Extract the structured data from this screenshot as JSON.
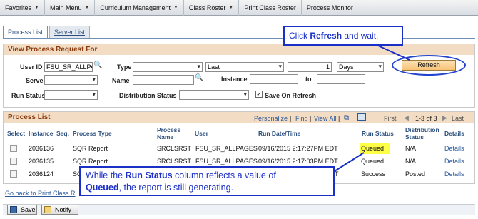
{
  "nav": {
    "items": [
      {
        "label": "Favorites",
        "caret": true
      },
      {
        "label": "Main Menu",
        "caret": true
      },
      {
        "label": "Curriculum Management",
        "caret": true
      },
      {
        "label": "Class Roster",
        "caret": true
      },
      {
        "label": "Print Class Roster",
        "caret": false
      },
      {
        "label": "Process Monitor",
        "caret": false
      }
    ]
  },
  "tabs": {
    "process_list": "Process List",
    "server_list": "Server List"
  },
  "request": {
    "title": "View Process Request For",
    "user_id_label": "User ID",
    "user_id_value": "FSU_SR_ALLPA",
    "type_label": "Type",
    "last_value": "Last",
    "number_value": "1",
    "days_value": "Days",
    "refresh_label": "Refresh",
    "server_label": "Server",
    "name_label": "Name",
    "instance_label": "Instance",
    "to_label": "to",
    "run_status_label": "Run Status",
    "distribution_status_label": "Distribution Status",
    "save_on_refresh_label": "Save On Refresh"
  },
  "process_list": {
    "title": "Process List",
    "personalize": "Personalize",
    "find": "Find",
    "view_all": "View All",
    "first": "First",
    "range": "1-3 of 3",
    "last": "Last",
    "columns": [
      "Select",
      "Instance",
      "Seq.",
      "Process Type",
      "Process Name",
      "User",
      "Run Date/Time",
      "Run Status",
      "Distribution Status",
      "Details"
    ],
    "rows": [
      {
        "instance": "2036136",
        "seq": "",
        "type": "SQR Report",
        "name": "SRCLSRST",
        "user": "FSU_SR_ALLPAGES",
        "datetime": "09/16/2015  2:17:27PM EDT",
        "status": "Queued",
        "dist": "N/A",
        "details": "Details"
      },
      {
        "instance": "2036135",
        "seq": "",
        "type": "SQR Report",
        "name": "SRCLSRST",
        "user": "FSU_SR_ALLPAGES",
        "datetime": "09/16/2015  2:17:03PM EDT",
        "status": "Queued",
        "dist": "N/A",
        "details": "Details"
      },
      {
        "instance": "2036124",
        "seq": "",
        "type": "SQ",
        "name": "",
        "user": "",
        "datetime": "T",
        "status": "Success",
        "dist": "Posted",
        "details": "Details"
      }
    ]
  },
  "back_link": "Go back to Print Class R",
  "buttons": {
    "save": "Save",
    "notify": "Notify"
  },
  "callouts": {
    "c1_pre": "Click ",
    "c1_bold": "Refresh",
    "c1_post": " and wait.",
    "c2_a": "While the ",
    "c2_b": "Run Status",
    "c2_c": " column reflects a value of",
    "c2_d": "Queued",
    "c2_e": ", the report is still generating."
  },
  "colors": {
    "accent": "#1a2fc7",
    "header_bg": "#f2dcc3",
    "highlight": "#ffff45"
  }
}
